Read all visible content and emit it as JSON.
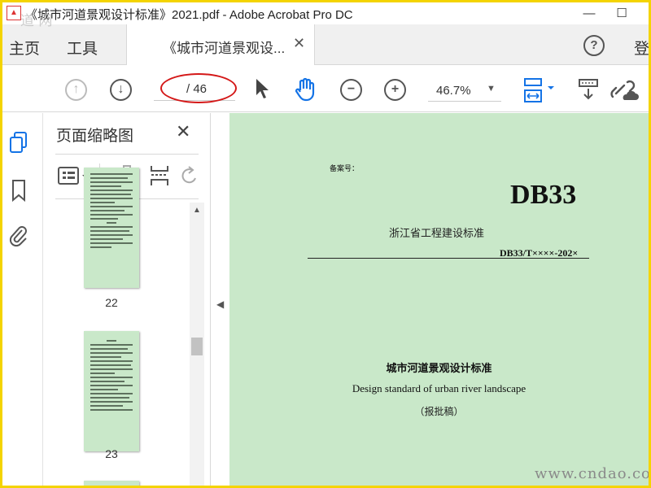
{
  "window": {
    "title": "《城市河道景观设计标准》2021.pdf - Adobe Acrobat Pro DC",
    "minimize": "—",
    "maximize": "☐"
  },
  "menu": {
    "home": "主页",
    "tools": "工具",
    "doc_tab": "《城市河道景观设...",
    "help": "?",
    "sign_in": "登"
  },
  "toolbar": {
    "page_current": "",
    "page_total": "/ 46",
    "zoom": "46.7%"
  },
  "thumbnail_pane": {
    "title": "页面缩略图",
    "pages": [
      {
        "label": "22"
      },
      {
        "label": "23"
      }
    ]
  },
  "document": {
    "record_no": "备案号：",
    "standard_code": "DB33",
    "issuer": "浙江省工程建设标准",
    "standard_number": "DB33/T××××-202×",
    "title_cn": "城市河道景观设计标准",
    "title_en": "Design standard of urban river landscape",
    "draft_status": "（报批稿）"
  },
  "watermark": {
    "site": "www.cndao.com",
    "logo_text": "道 网"
  },
  "colors": {
    "frame_border": "#f4d400",
    "page_background": "#c9e8c9",
    "annotation_ellipse": "#d41818",
    "accent_blue": "#1473e6"
  }
}
